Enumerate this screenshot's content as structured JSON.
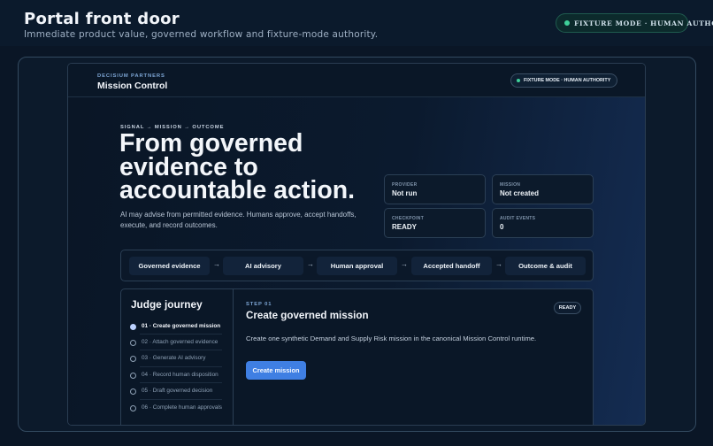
{
  "page": {
    "title": "Portal front door",
    "subtitle": "Immediate product value, governed workflow and fixture-mode authority.",
    "mode_badge": "FIXTURE MODE · HUMAN AUTHORITY"
  },
  "app": {
    "brand_small": "DECISIUM PARTNERS",
    "brand_title": "Mission Control",
    "mode_badge": "FIXTURE MODE · HUMAN AUTHORITY"
  },
  "hero": {
    "kicker": "SIGNAL → MISSION → OUTCOME",
    "headline_lines": [
      "From governed",
      "evidence to",
      "accountable action."
    ],
    "lede": "AI may advise from permitted evidence. Humans approve, accept handoffs, execute, and record outcomes."
  },
  "stats": [
    {
      "label": "PROVIDER",
      "value": "Not run"
    },
    {
      "label": "MISSION",
      "value": "Not created"
    },
    {
      "label": "CHECKPOINT",
      "value": "READY"
    },
    {
      "label": "AUDIT EVENTS",
      "value": "0"
    }
  ],
  "pipeline": {
    "steps": [
      "Governed evidence",
      "AI advisory",
      "Human approval",
      "Accepted handoff",
      "Outcome & audit"
    ],
    "arrow": "→"
  },
  "journey": {
    "title": "Judge journey",
    "items": [
      {
        "label": "01 · Create governed mission",
        "active": true
      },
      {
        "label": "02 · Attach governed evidence",
        "active": false
      },
      {
        "label": "03 · Generate AI advisory",
        "active": false
      },
      {
        "label": "04 · Record human disposition",
        "active": false
      },
      {
        "label": "05 · Draft governed decision",
        "active": false
      },
      {
        "label": "06 · Complete human approvals",
        "active": false
      }
    ]
  },
  "step": {
    "tag": "STEP 01",
    "title": "Create governed mission",
    "status": "READY",
    "description": "Create one synthetic Demand and Supply Risk mission in the canonical Mission Control runtime.",
    "action_label": "Create mission"
  },
  "colors": {
    "accent": "#3f7fe3",
    "status_ok": "#3fd19a",
    "background": "#0a1626"
  }
}
